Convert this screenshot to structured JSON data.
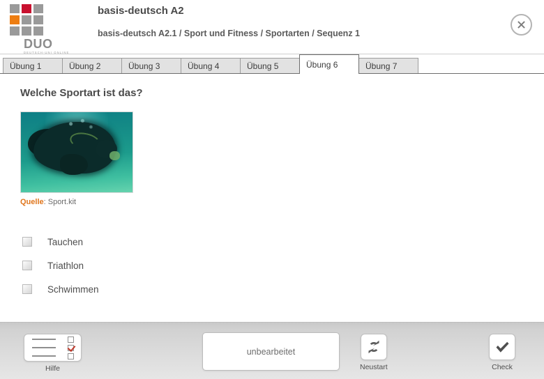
{
  "header": {
    "logo": {
      "word": "DUO",
      "subtitle": "DEUTSCH-UNI ONLINE",
      "cells": [
        "gray",
        "red",
        "gray",
        "orange",
        "gray",
        "gray",
        "gray",
        "gray",
        "gray"
      ],
      "colors": {
        "gray": "#9a9a9a",
        "red": "#c8102e",
        "orange": "#ee7d11"
      }
    },
    "title": "basis-deutsch A2",
    "breadcrumb": "basis-deutsch A2.1 / Sport und Fitness / Sportarten / Sequenz 1",
    "close_icon": "close-icon"
  },
  "tabs": {
    "items": [
      {
        "label": "Übung 1",
        "active": false
      },
      {
        "label": "Übung 2",
        "active": false
      },
      {
        "label": "Übung 3",
        "active": false
      },
      {
        "label": "Übung 4",
        "active": false
      },
      {
        "label": "Übung 5",
        "active": false
      },
      {
        "label": "Übung 6",
        "active": true
      },
      {
        "label": "Übung 7",
        "active": false
      }
    ]
  },
  "exercise": {
    "question": "Welche Sportart ist das?",
    "image": {
      "alt": "underwater scuba diver photo",
      "source_label": "Quelle",
      "source_value": ": Sport.kit",
      "source_label_color": "#e0761d"
    },
    "options": [
      {
        "label": "Tauchen",
        "checked": false
      },
      {
        "label": "Triathlon",
        "checked": false
      },
      {
        "label": "Schwimmen",
        "checked": false
      }
    ]
  },
  "footer": {
    "help": {
      "label": "Hilfe",
      "icon": "help-checklist-icon"
    },
    "status": {
      "value": "unbearbeitet"
    },
    "restart": {
      "label": "Neustart",
      "icon": "refresh-icon"
    },
    "check": {
      "label": "Check",
      "icon": "checkmark-icon"
    }
  }
}
